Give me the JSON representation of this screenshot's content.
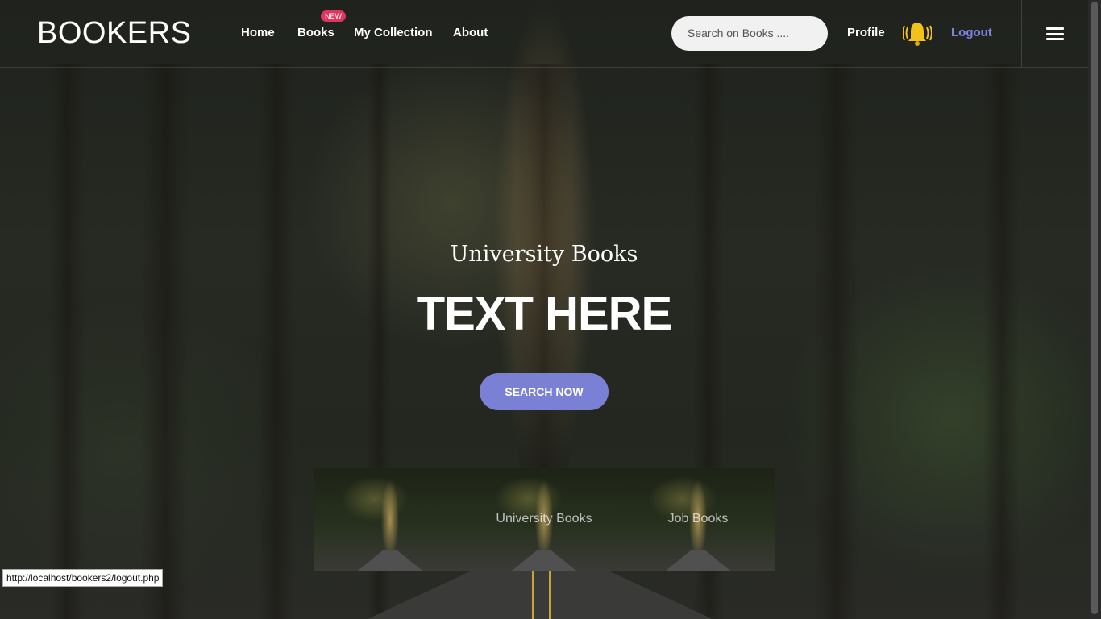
{
  "header": {
    "logo": "BOOKERS",
    "nav": [
      {
        "label": "Home"
      },
      {
        "label": "Books",
        "badge": "NEW"
      },
      {
        "label": "My Collection"
      },
      {
        "label": "About"
      }
    ],
    "search_placeholder": "Search on Books ....",
    "profile": "Profile",
    "logout": "Logout",
    "icons": [
      "bell-icon",
      "hamburger-menu-icon"
    ]
  },
  "hero": {
    "subtitle": "University Books",
    "headline": "TEXT HERE",
    "cta": "SEARCH NOW"
  },
  "tiles": [
    {
      "label": ""
    },
    {
      "label": "University Books"
    },
    {
      "label": "Job Books"
    }
  ],
  "status_bar": {
    "url": "http://localhost/bookers2/logout.php"
  },
  "colors": {
    "accent": "#7a80d4",
    "logout": "#7b85df",
    "badge": "#e0365e",
    "bell": "#f2c21b"
  }
}
